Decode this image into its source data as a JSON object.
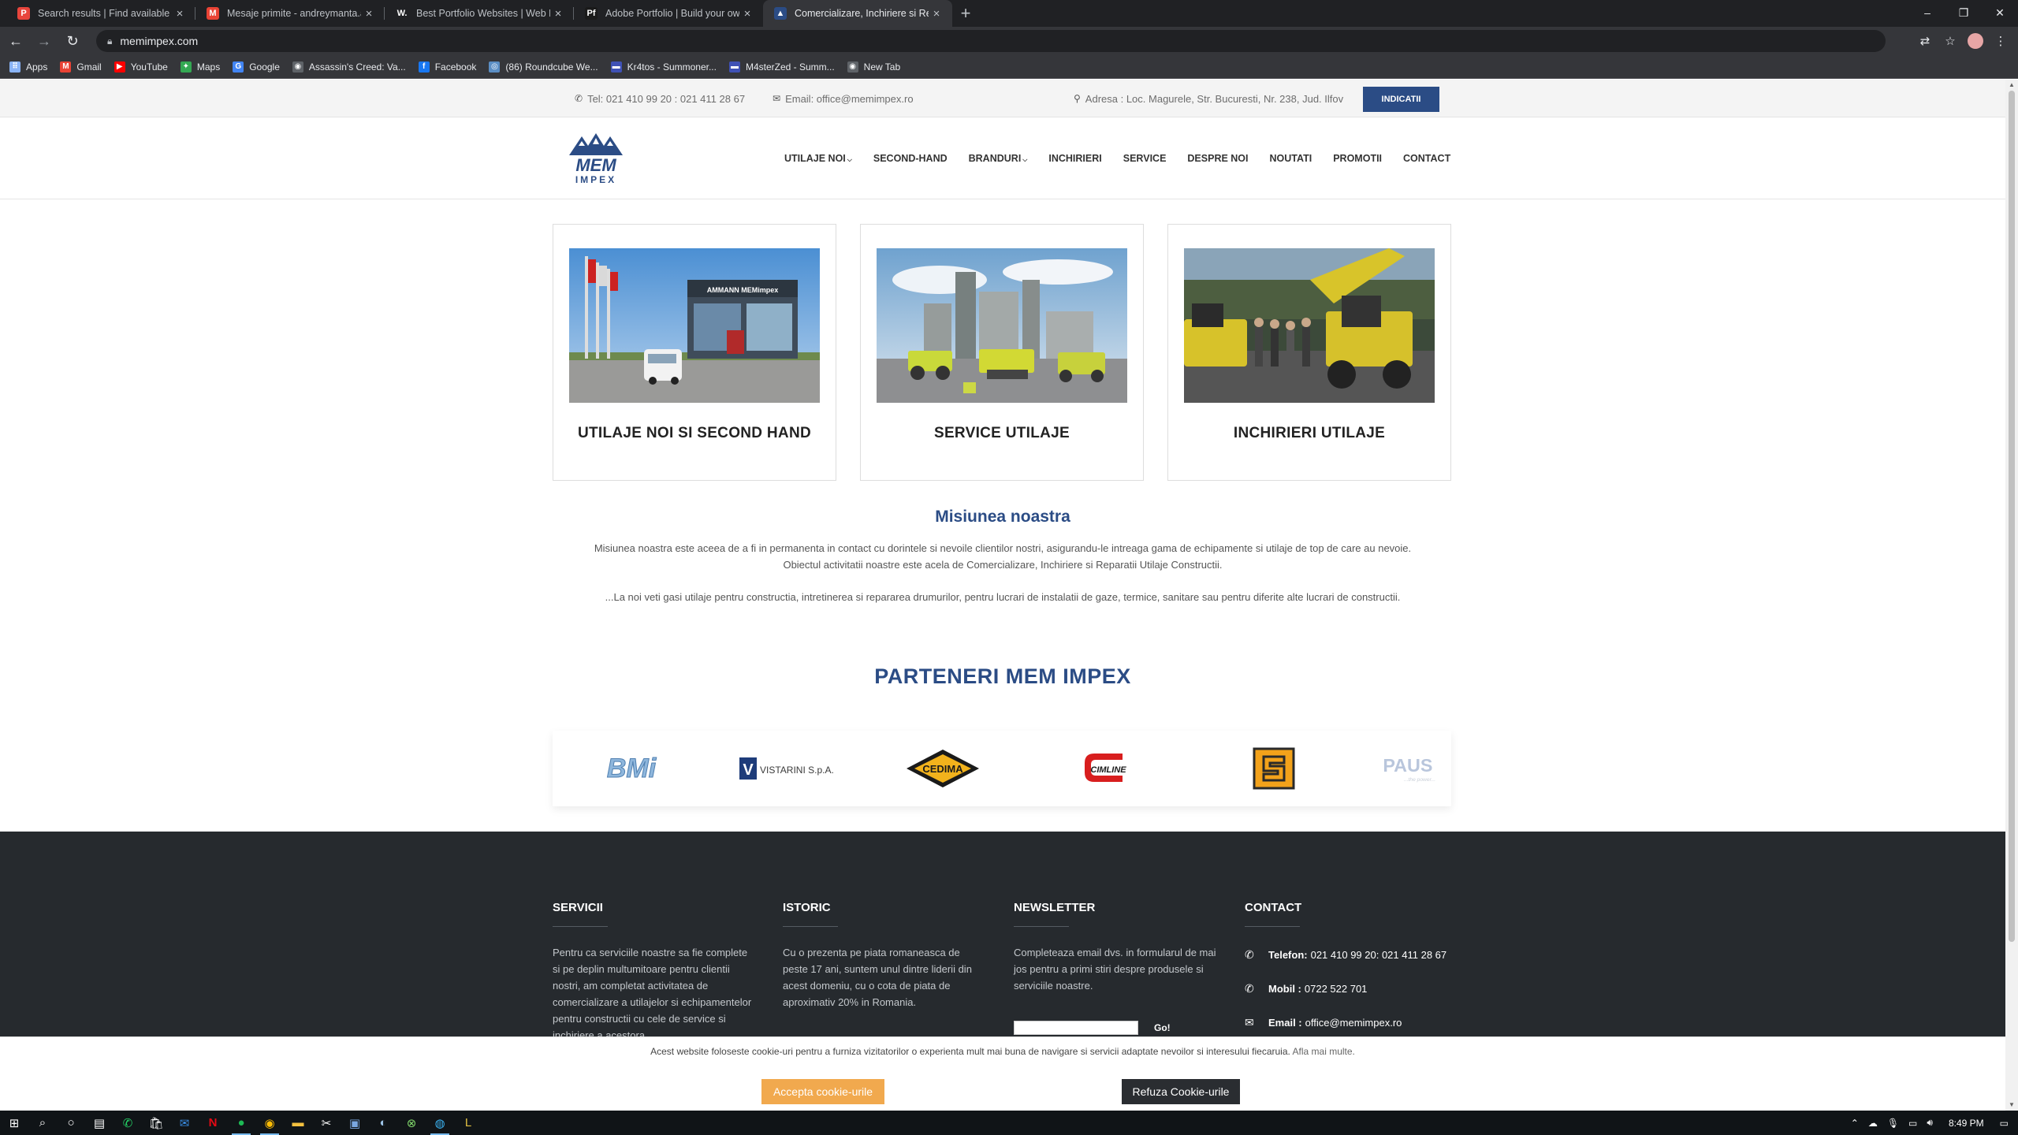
{
  "browser": {
    "tabs": [
      {
        "title": "Search results | Find available job",
        "fav_color": "#e8453c",
        "fav_glyph": "P"
      },
      {
        "title": "Mesaje primite - andreymanta.ar",
        "fav_color": "#ea4335",
        "fav_glyph": "M"
      },
      {
        "title": "Best Portfolio Websites | Web De",
        "fav_color": "#202124",
        "fav_glyph": "W."
      },
      {
        "title": "Adobe Portfolio | Build your own",
        "fav_color": "#1a1a1a",
        "fav_glyph": "Pf"
      },
      {
        "title": "Comercializare, Inchiriere si Repa",
        "fav_color": "#2b4c85",
        "fav_glyph": "▲"
      }
    ],
    "active_tab": 4,
    "url": "memimpex.com",
    "bookmarks": [
      {
        "label": "Apps",
        "color": "#8ab4f8",
        "glyph": "⠿"
      },
      {
        "label": "Gmail",
        "color": "#ea4335",
        "glyph": "M"
      },
      {
        "label": "YouTube",
        "color": "#ff0000",
        "glyph": "▶"
      },
      {
        "label": "Maps",
        "color": "#34a853",
        "glyph": "✦"
      },
      {
        "label": "Google",
        "color": "#4285f4",
        "glyph": "G"
      },
      {
        "label": "Assassin's Creed: Va...",
        "color": "#5f6368",
        "glyph": "◉"
      },
      {
        "label": "Facebook",
        "color": "#1877f2",
        "glyph": "f"
      },
      {
        "label": "(86) Roundcube We...",
        "color": "#5b8ec4",
        "glyph": "◎"
      },
      {
        "label": "Kr4tos - Summoner...",
        "color": "#3f51b5",
        "glyph": "▬"
      },
      {
        "label": "M4sterZed - Summ...",
        "color": "#3f51b5",
        "glyph": "▬"
      },
      {
        "label": "New Tab",
        "color": "#5f6368",
        "glyph": "◉"
      }
    ]
  },
  "topbar": {
    "phone": "Tel: 021 410 99 20 : 021 411 28 67",
    "email": "Email: office@memimpex.ro",
    "address": "Adresa : Loc. Magurele, Str. Bucuresti, Nr. 238, Jud. Ilfov",
    "directions_button": "INDICATII"
  },
  "logo": {
    "text_top": "MEM",
    "text_bottom": "IMPEX",
    "color": "#2b4c85"
  },
  "nav": [
    {
      "label": "UTILAJE NOI",
      "dropdown": true
    },
    {
      "label": "SECOND-HAND",
      "dropdown": false
    },
    {
      "label": "BRANDURI",
      "dropdown": true
    },
    {
      "label": "INCHIRIERI",
      "dropdown": false
    },
    {
      "label": "SERVICE",
      "dropdown": false
    },
    {
      "label": "DESPRE NOI",
      "dropdown": false
    },
    {
      "label": "NOUTATI",
      "dropdown": false
    },
    {
      "label": "PROMOTII",
      "dropdown": false
    },
    {
      "label": "CONTACT",
      "dropdown": false
    }
  ],
  "cards": [
    {
      "caption": "UTILAJE NOI SI SECOND HAND",
      "sign": "AMMANN  MEMimpex"
    },
    {
      "caption": "SERVICE UTILAJE"
    },
    {
      "caption": "INCHIRIERI UTILAJE"
    }
  ],
  "mission": {
    "title": "Misiunea noastra",
    "p1": "Misiunea noastra este aceea de a fi in permanenta in contact cu dorintele si nevoile clientilor nostri, asigurandu-le intreaga gama de echipamente si utilaje de top de care au nevoie.",
    "p2": "Obiectul activitatii noastre este acela de Comercializare, Inchiriere si Reparatii Utilaje Constructii.",
    "p3": "...La noi veti gasi utilaje pentru constructia, intretinerea si repararea drumurilor, pentru lucrari de instalatii de gaze, termice, sanitare sau pentru diferite alte lucrari de constructii."
  },
  "partners": {
    "title": "PARTENERI MEM IMPEX",
    "logos": [
      {
        "name": "BMi"
      },
      {
        "name": "VISTARINI S.p.A."
      },
      {
        "name": "CEDIMA"
      },
      {
        "name": "CIMLINE"
      },
      {
        "name": "S"
      },
      {
        "name": "PAUS",
        "tagline": "...the power..."
      }
    ]
  },
  "footer": {
    "services": {
      "title": "SERVICII",
      "text": "Pentru ca serviciile noastre sa fie complete si pe deplin multumitoare pentru clientii nostri, am completat activitatea de comercializare a utilajelor si echipamentelor pentru constructii cu cele de service si inchiriere a acestora."
    },
    "history": {
      "title": "ISTORIC",
      "text": "Cu o prezenta pe piata romaneasca de peste 17 ani, suntem unul dintre liderii din acest domeniu, cu o cota de piata de aproximativ 20% in Romania."
    },
    "newsletter": {
      "title": "NEWSLETTER",
      "text": "Completeaza email dvs. in formularul de mai jos pentru a primi stiri despre produsele si serviciile noastre.",
      "button": "Go!",
      "input_value": ""
    },
    "contact": {
      "title": "CONTACT",
      "phone_label": "Telefon:",
      "phone": "021 410 99 20: 021 411 28 67",
      "mobile_label": "Mobil :",
      "mobile": "0722 522 701",
      "email_label": "Email :",
      "email": "office@memimpex.ro"
    }
  },
  "cookie": {
    "text": "Acest website foloseste cookie-uri pentru a furniza vizitatorilor o experienta mult mai buna de navigare si servicii adaptate nevoilor si interesului fiecaruia.",
    "link": "Afla mai multe.",
    "accept": "Accepta cookie-urile",
    "refuse": "Refuza Cookie-urile"
  },
  "taskbar": {
    "time": "8:49 PM"
  }
}
